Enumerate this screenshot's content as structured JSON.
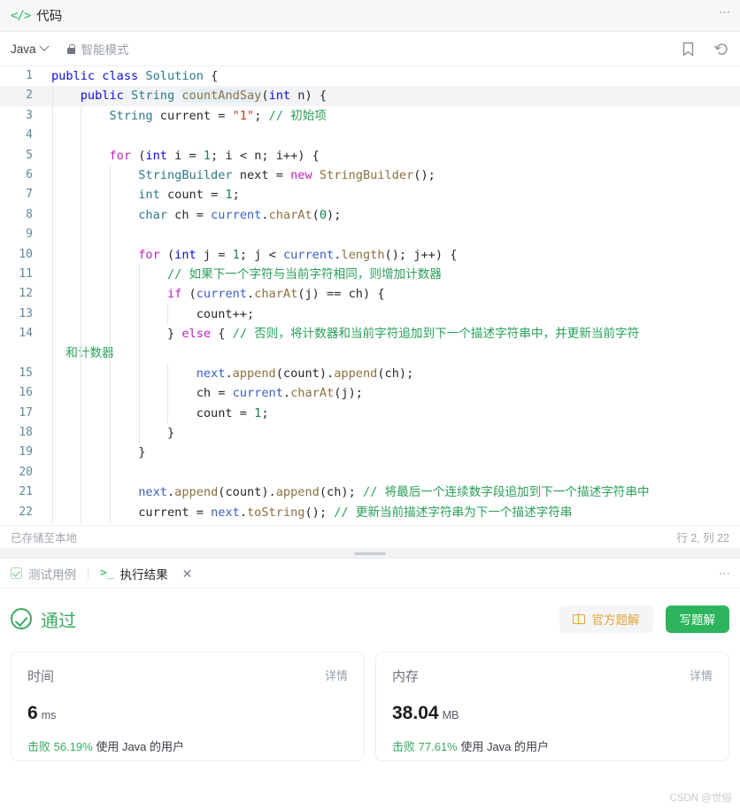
{
  "header": {
    "title": "代码",
    "code_icon": "code-brackets-icon",
    "menu_dots": "⋯"
  },
  "toolbar": {
    "language": "Java",
    "mode_label": "智能模式",
    "bookmark_icon": "bookmark-icon",
    "reset_icon": "reset-icon"
  },
  "editor": {
    "lines": [
      {
        "n": "1",
        "tokens": [
          {
            "t": "public",
            "c": "kw"
          },
          {
            "t": " ",
            "c": "pl"
          },
          {
            "t": "class",
            "c": "kw"
          },
          {
            "t": " ",
            "c": "pl"
          },
          {
            "t": "Solution",
            "c": "type"
          },
          {
            "t": " {",
            "c": "pl"
          }
        ]
      },
      {
        "n": "2",
        "active": true,
        "indent": 1,
        "tokens": [
          {
            "t": "    ",
            "c": "pl"
          },
          {
            "t": "public",
            "c": "kw"
          },
          {
            "t": " ",
            "c": "pl"
          },
          {
            "t": "String",
            "c": "type"
          },
          {
            "t": " ",
            "c": "pl"
          },
          {
            "t": "countAndSay",
            "c": "fn sel"
          },
          {
            "t": "(",
            "c": "pl"
          },
          {
            "t": "int",
            "c": "kw"
          },
          {
            "t": " n) {",
            "c": "pl"
          }
        ]
      },
      {
        "n": "3",
        "indent": 2,
        "tokens": [
          {
            "t": "        ",
            "c": "pl"
          },
          {
            "t": "String",
            "c": "type"
          },
          {
            "t": " current = ",
            "c": "pl"
          },
          {
            "t": "\"1\"",
            "c": "str"
          },
          {
            "t": "; ",
            "c": "pl"
          },
          {
            "t": "// 初始项",
            "c": "cmt"
          }
        ]
      },
      {
        "n": "4",
        "indent": 2,
        "tokens": []
      },
      {
        "n": "5",
        "indent": 2,
        "tokens": [
          {
            "t": "        ",
            "c": "pl"
          },
          {
            "t": "for",
            "c": "kw2"
          },
          {
            "t": " (",
            "c": "pl"
          },
          {
            "t": "int",
            "c": "kw"
          },
          {
            "t": " i = ",
            "c": "pl"
          },
          {
            "t": "1",
            "c": "num"
          },
          {
            "t": "; i < n; i++) {",
            "c": "pl"
          }
        ]
      },
      {
        "n": "6",
        "indent": 3,
        "tokens": [
          {
            "t": "            ",
            "c": "pl"
          },
          {
            "t": "StringBuilder",
            "c": "type"
          },
          {
            "t": " next = ",
            "c": "pl"
          },
          {
            "t": "new",
            "c": "kw2"
          },
          {
            "t": " ",
            "c": "pl"
          },
          {
            "t": "StringBuilder",
            "c": "fn"
          },
          {
            "t": "();",
            "c": "pl"
          }
        ]
      },
      {
        "n": "7",
        "indent": 3,
        "tokens": [
          {
            "t": "            ",
            "c": "pl"
          },
          {
            "t": "int",
            "c": "type"
          },
          {
            "t": " count = ",
            "c": "pl"
          },
          {
            "t": "1",
            "c": "num"
          },
          {
            "t": ";",
            "c": "pl"
          }
        ]
      },
      {
        "n": "8",
        "indent": 3,
        "tokens": [
          {
            "t": "            ",
            "c": "pl"
          },
          {
            "t": "char",
            "c": "type"
          },
          {
            "t": " ch = ",
            "c": "pl"
          },
          {
            "t": "current",
            "c": "var"
          },
          {
            "t": ".",
            "c": "pl"
          },
          {
            "t": "charAt",
            "c": "fn"
          },
          {
            "t": "(",
            "c": "pl"
          },
          {
            "t": "0",
            "c": "num"
          },
          {
            "t": ");",
            "c": "pl"
          }
        ]
      },
      {
        "n": "9",
        "indent": 3,
        "tokens": []
      },
      {
        "n": "10",
        "indent": 3,
        "tokens": [
          {
            "t": "            ",
            "c": "pl"
          },
          {
            "t": "for",
            "c": "kw2"
          },
          {
            "t": " (",
            "c": "pl"
          },
          {
            "t": "int",
            "c": "kw"
          },
          {
            "t": " j = ",
            "c": "pl"
          },
          {
            "t": "1",
            "c": "num"
          },
          {
            "t": "; j < ",
            "c": "pl"
          },
          {
            "t": "current",
            "c": "var"
          },
          {
            "t": ".",
            "c": "pl"
          },
          {
            "t": "length",
            "c": "fn"
          },
          {
            "t": "(); j++) {",
            "c": "pl"
          }
        ]
      },
      {
        "n": "11",
        "indent": 4,
        "tokens": [
          {
            "t": "                ",
            "c": "pl"
          },
          {
            "t": "// 如果下一个字符与当前字符相同，则增加计数器",
            "c": "cmt"
          }
        ]
      },
      {
        "n": "12",
        "indent": 4,
        "tokens": [
          {
            "t": "                ",
            "c": "pl"
          },
          {
            "t": "if",
            "c": "kw2"
          },
          {
            "t": " (",
            "c": "pl"
          },
          {
            "t": "current",
            "c": "var"
          },
          {
            "t": ".",
            "c": "pl"
          },
          {
            "t": "charAt",
            "c": "fn"
          },
          {
            "t": "(j) == ch) {",
            "c": "pl"
          }
        ]
      },
      {
        "n": "13",
        "indent": 5,
        "tokens": [
          {
            "t": "                    ",
            "c": "pl"
          },
          {
            "t": "count++;",
            "c": "pl"
          }
        ]
      },
      {
        "n": "14",
        "indent": 4,
        "wrap": true,
        "tokens": [
          {
            "t": "                ",
            "c": "pl"
          },
          {
            "t": "} ",
            "c": "pl"
          },
          {
            "t": "else",
            "c": "kw2"
          },
          {
            "t": " { ",
            "c": "pl"
          },
          {
            "t": "// 否则，将计数器和当前字符追加到下一个描述字符串中，并更新当前字符",
            "c": "cmt"
          }
        ],
        "wrap_tokens": [
          {
            "t": "和计数器",
            "c": "cmt"
          }
        ]
      },
      {
        "n": "15",
        "indent": 5,
        "tokens": [
          {
            "t": "                    ",
            "c": "pl"
          },
          {
            "t": "next",
            "c": "var"
          },
          {
            "t": ".",
            "c": "pl"
          },
          {
            "t": "append",
            "c": "fn"
          },
          {
            "t": "(count).",
            "c": "pl"
          },
          {
            "t": "append",
            "c": "fn"
          },
          {
            "t": "(ch);",
            "c": "pl"
          }
        ]
      },
      {
        "n": "16",
        "indent": 5,
        "tokens": [
          {
            "t": "                    ",
            "c": "pl"
          },
          {
            "t": "ch = ",
            "c": "pl"
          },
          {
            "t": "current",
            "c": "var"
          },
          {
            "t": ".",
            "c": "pl"
          },
          {
            "t": "charAt",
            "c": "fn"
          },
          {
            "t": "(j);",
            "c": "pl"
          }
        ]
      },
      {
        "n": "17",
        "indent": 5,
        "tokens": [
          {
            "t": "                    ",
            "c": "pl"
          },
          {
            "t": "count = ",
            "c": "pl"
          },
          {
            "t": "1",
            "c": "num"
          },
          {
            "t": ";",
            "c": "pl"
          }
        ]
      },
      {
        "n": "18",
        "indent": 4,
        "tokens": [
          {
            "t": "                ",
            "c": "pl"
          },
          {
            "t": "}",
            "c": "pl"
          }
        ]
      },
      {
        "n": "19",
        "indent": 3,
        "tokens": [
          {
            "t": "            ",
            "c": "pl"
          },
          {
            "t": "}",
            "c": "pl"
          }
        ]
      },
      {
        "n": "20",
        "indent": 3,
        "tokens": []
      },
      {
        "n": "21",
        "indent": 3,
        "tokens": [
          {
            "t": "            ",
            "c": "pl"
          },
          {
            "t": "next",
            "c": "var"
          },
          {
            "t": ".",
            "c": "pl"
          },
          {
            "t": "append",
            "c": "fn"
          },
          {
            "t": "(count).",
            "c": "pl"
          },
          {
            "t": "append",
            "c": "fn"
          },
          {
            "t": "(ch); ",
            "c": "pl"
          },
          {
            "t": "// 将最后一个连续数字段追加到下一个描述字符串中",
            "c": "cmt"
          }
        ]
      },
      {
        "n": "22",
        "indent": 3,
        "tokens": [
          {
            "t": "            ",
            "c": "pl"
          },
          {
            "t": "current = ",
            "c": "pl"
          },
          {
            "t": "next",
            "c": "var"
          },
          {
            "t": ".",
            "c": "pl"
          },
          {
            "t": "toString",
            "c": "fn"
          },
          {
            "t": "(); ",
            "c": "pl"
          },
          {
            "t": "// 更新当前描述字符串为下一个描述字符串",
            "c": "cmt"
          }
        ]
      }
    ]
  },
  "status": {
    "saved": "已存储至本地",
    "cursor": "行 2, 列 22"
  },
  "result_tabs": {
    "testcase": "测试用例",
    "execution": "执行结果",
    "close_icon": "close-icon",
    "menu_dots": "⋯",
    "prompt_icon": ">_"
  },
  "result": {
    "verdict": "通过",
    "verdict_icon": "check-circle-icon",
    "official_solution": "官方题解",
    "write_solution": "写题解",
    "book_icon": "book-icon",
    "cards": [
      {
        "title": "时间",
        "detail": "详情",
        "value": "6",
        "unit": "ms",
        "beat_prefix": "击败",
        "beat_pct": "56.19%",
        "beat_suffix": "使用 Java 的用户"
      },
      {
        "title": "内存",
        "detail": "详情",
        "value": "38.04",
        "unit": "MB",
        "beat_prefix": "击败",
        "beat_pct": "77.61%",
        "beat_suffix": "使用 Java 的用户"
      }
    ]
  },
  "watermark": "CSDN @世俗",
  "colors": {
    "accent_green": "#2db55d",
    "orange": "#e8a33d",
    "line_number": "#5b8a9c"
  }
}
